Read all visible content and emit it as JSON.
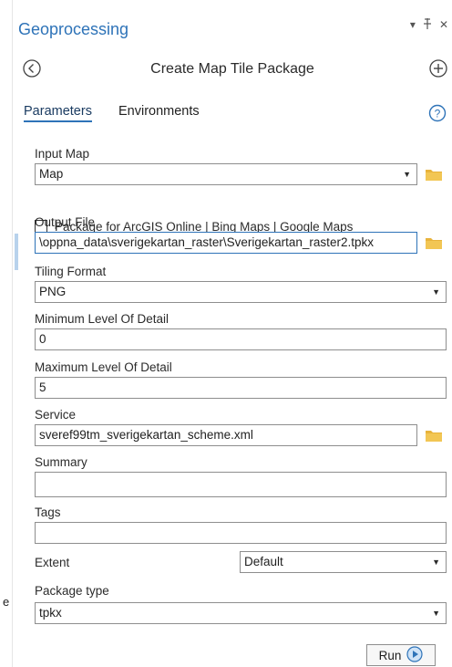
{
  "pane": {
    "title": "Geoprocessing",
    "controls": {
      "menu": "▾",
      "pin": "ᵖ",
      "close": "✕"
    }
  },
  "tool": {
    "title": "Create Map Tile Package"
  },
  "tabs": [
    {
      "label": "Parameters",
      "active": true
    },
    {
      "label": "Environments",
      "active": false
    }
  ],
  "params": {
    "input_map": {
      "label": "Input Map",
      "value": "Map"
    },
    "package_online": {
      "label": "Package for ArcGIS Online | Bing Maps | Google Maps",
      "checked": false
    },
    "output_file": {
      "label": "Output File",
      "value": "\\oppna_data\\sverigekartan_raster\\Sverigekartan_raster2.tpkx"
    },
    "tiling_format": {
      "label": "Tiling Format",
      "value": "PNG"
    },
    "min_lod": {
      "label": "Minimum Level Of Detail",
      "value": "0"
    },
    "max_lod": {
      "label": "Maximum Level Of Detail",
      "value": "5"
    },
    "service": {
      "label": "Service",
      "value": "sveref99tm_sverigekartan_scheme.xml"
    },
    "summary": {
      "label": "Summary",
      "value": ""
    },
    "tags": {
      "label": "Tags",
      "value": ""
    },
    "extent": {
      "label": "Extent",
      "value": "Default"
    },
    "package_type": {
      "label": "Package type",
      "value": "tpkx"
    }
  },
  "run": {
    "label": "Run"
  },
  "left_stub": "e",
  "icons": {
    "back": "back-arrow-icon",
    "add": "add-icon",
    "help": "help-icon",
    "folder": "folder-icon",
    "run": "run-play-icon"
  },
  "colors": {
    "accent": "#2e73b8",
    "folder": "#e8b33c"
  }
}
